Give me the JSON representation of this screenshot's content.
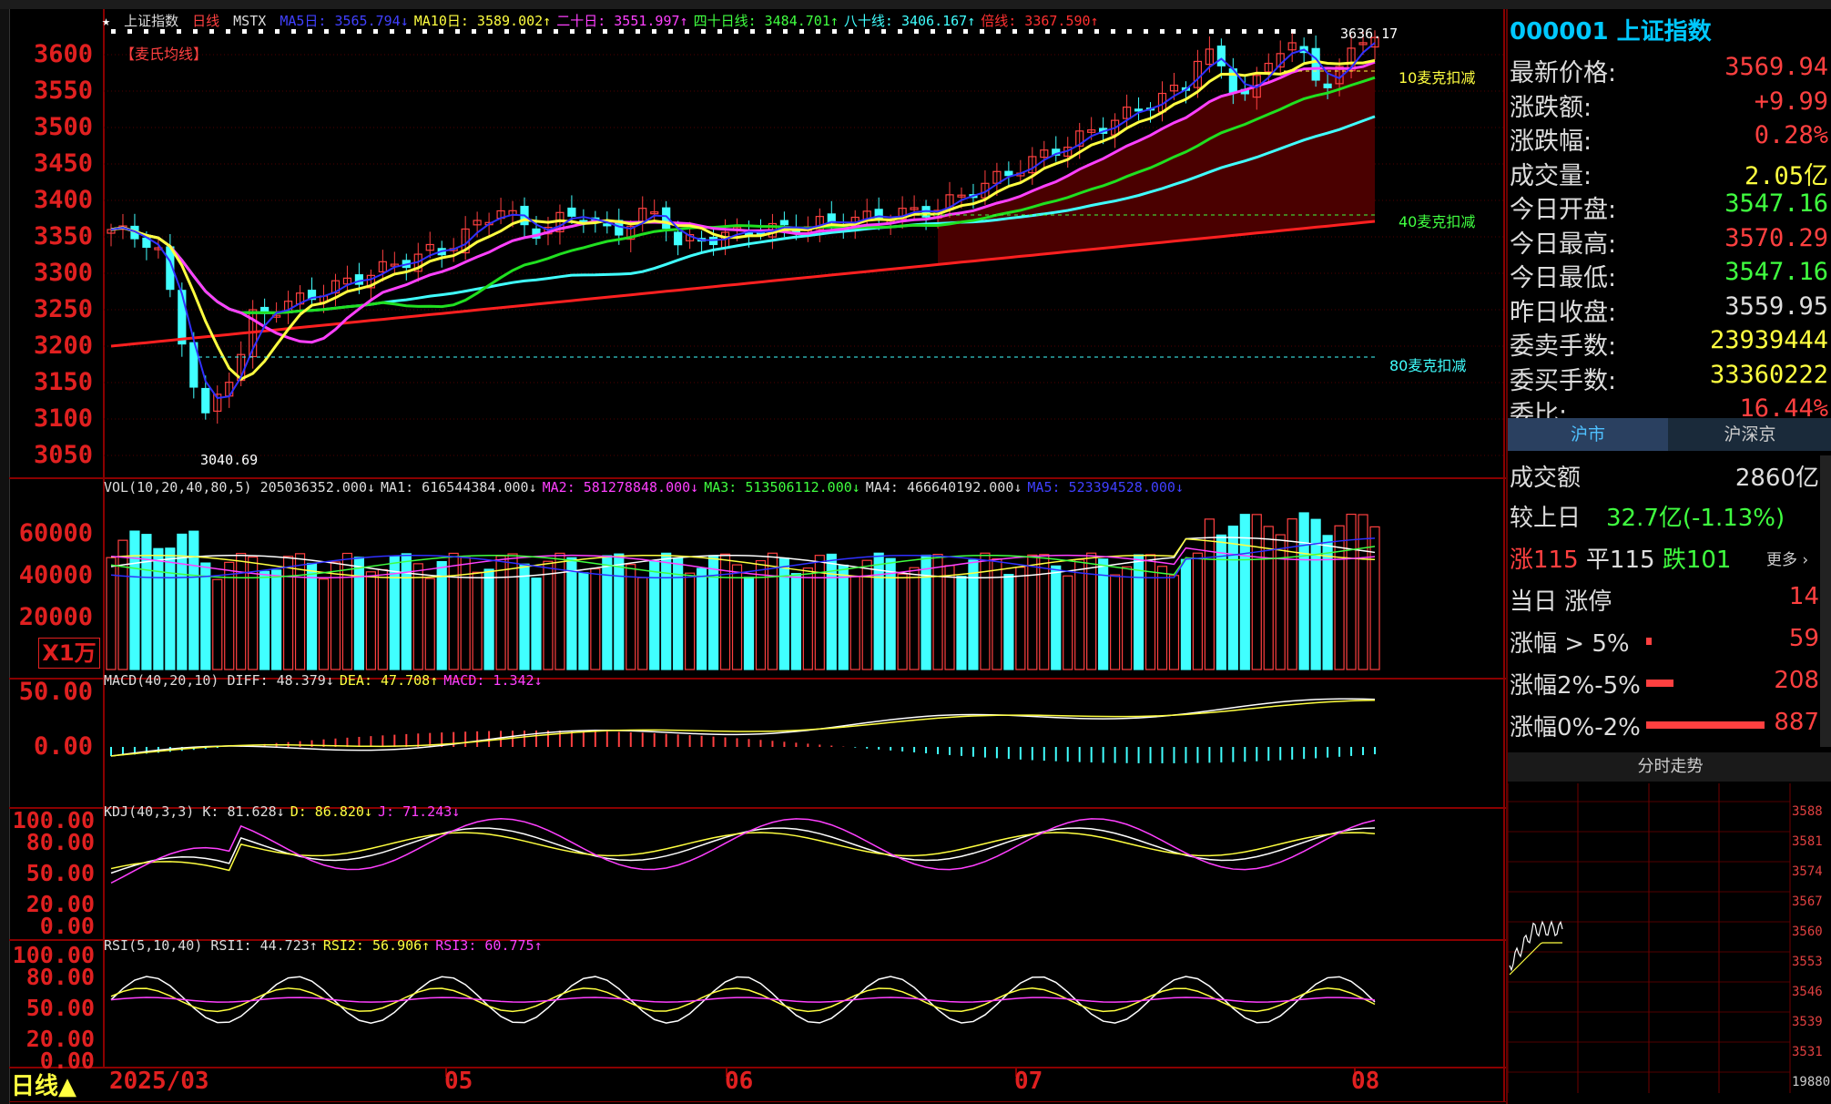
{
  "main_legend": {
    "prefix": "★",
    "title": "上证指数",
    "period": "日线",
    "indicator": "MSTX",
    "items": [
      {
        "label": "MA5日: 3565.794↓",
        "color": "#4040ff"
      },
      {
        "label": "MA10日: 3589.002↑",
        "color": "#ffff40"
      },
      {
        "label": "二十日: 3551.997↑",
        "color": "#ff40ff"
      },
      {
        "label": "四十日线: 3484.701↑",
        "color": "#40ff40"
      },
      {
        "label": "八十线: 3406.167↑",
        "color": "#40ffff"
      },
      {
        "label": "倍线: 3367.590↑",
        "color": "#ff3030"
      }
    ],
    "badge": "【麦氏均线】"
  },
  "price_axis": [
    "3600",
    "3550",
    "3500",
    "3450",
    "3400",
    "3350",
    "3300",
    "3250",
    "3200",
    "3150",
    "3100",
    "3050"
  ],
  "annotations": {
    "high": "3636.17",
    "low": "3040.69",
    "mk10": "10麦克扣减",
    "mk40": "40麦克扣减",
    "mk80": "80麦克扣减"
  },
  "vol_legend": [
    {
      "label": "VOL(10,20,40,80,5) 205036352.000↓",
      "color": "#dddddd"
    },
    {
      "label": "MA1: 616544384.000↓",
      "color": "#dddddd"
    },
    {
      "label": "MA2: 581278848.000↓",
      "color": "#ff40ff"
    },
    {
      "label": "MA3: 513506112.000↓",
      "color": "#40ff40"
    },
    {
      "label": "MA4: 466640192.000↓",
      "color": "#dddddd"
    },
    {
      "label": "MA5: 523394528.000↓",
      "color": "#4040ff"
    }
  ],
  "vol_axis": [
    "60000",
    "40000",
    "20000"
  ],
  "vol_unit": "X1万",
  "macd_legend": [
    {
      "label": "MACD(40,20,10) DIFF: 48.379↓",
      "color": "#dddddd"
    },
    {
      "label": "DEA: 47.708↑",
      "color": "#ffff40"
    },
    {
      "label": "MACD: 1.342↓",
      "color": "#ff40ff"
    }
  ],
  "macd_axis": [
    "50.00",
    "0.00"
  ],
  "kdj_legend": [
    {
      "label": "KDJ(40,3,3) K: 81.628↓",
      "color": "#dddddd"
    },
    {
      "label": "D: 86.820↓",
      "color": "#ffff40"
    },
    {
      "label": "J: 71.243↓",
      "color": "#ff40ff"
    }
  ],
  "kdj_axis": [
    "100.00",
    "80.00",
    "50.00",
    "20.00",
    "0.00"
  ],
  "rsi_legend": [
    {
      "label": "RSI(5,10,40) RSI1: 44.723↑",
      "color": "#dddddd"
    },
    {
      "label": "RSI2: 56.906↑",
      "color": "#ffff40"
    },
    {
      "label": "RSI3: 60.775↑",
      "color": "#ff40ff"
    }
  ],
  "rsi_axis": [
    "100.00",
    "80.00",
    "50.00",
    "20.00",
    "0.00"
  ],
  "time_axis": {
    "period_btn": "日线▲",
    "labels": [
      "2025/03",
      "05",
      "06",
      "07",
      "08"
    ]
  },
  "quote": {
    "code_name": "000001 上证指数",
    "rows": [
      {
        "k": "最新价格:",
        "v": "3569.94",
        "color": "#ff4040"
      },
      {
        "k": "涨跌额:",
        "v": "+9.99",
        "color": "#ff4040"
      },
      {
        "k": "涨跌幅:",
        "v": "0.28%",
        "color": "#ff4040"
      },
      {
        "k": "成交量:",
        "v": "2.05亿",
        "color": "#ffff40"
      },
      {
        "k": "今日开盘:",
        "v": "3547.16",
        "color": "#40ff40"
      },
      {
        "k": "今日最高:",
        "v": "3570.29",
        "color": "#ff4040"
      },
      {
        "k": "今日最低:",
        "v": "3547.16",
        "color": "#40ff40"
      },
      {
        "k": "昨日收盘:",
        "v": "3559.95",
        "color": "#dddddd"
      },
      {
        "k": "委卖手数:",
        "v": "23939444",
        "color": "#ffff40"
      },
      {
        "k": "委买手数:",
        "v": "33360222",
        "color": "#ffff40"
      },
      {
        "k": "委比:",
        "v": "16.44%",
        "color": "#ff4040"
      }
    ]
  },
  "market_tabs": [
    "沪市",
    "沪深京"
  ],
  "market": {
    "turnover_k": "成交额",
    "turnover_v": "2860亿",
    "vs_k": "较上日",
    "vs_v": "32.7亿(-1.13%)",
    "up": "涨115",
    "flat": "平115",
    "down": "跌101",
    "more": "更多 ›",
    "limit_k": "当日  涨停",
    "limit_v": "14",
    "r1_k": "涨幅 > 5%",
    "r1_v": "59",
    "r2_k": "涨幅2%-5%",
    "r2_v": "208",
    "r3_k": "涨幅0%-2%",
    "r3_v": "887"
  },
  "intraday": {
    "title": "分时走势",
    "axis": [
      "3588",
      "3581",
      "3574",
      "3567",
      "3560",
      "3553",
      "3546",
      "3539",
      "3531",
      "19880"
    ]
  }
}
